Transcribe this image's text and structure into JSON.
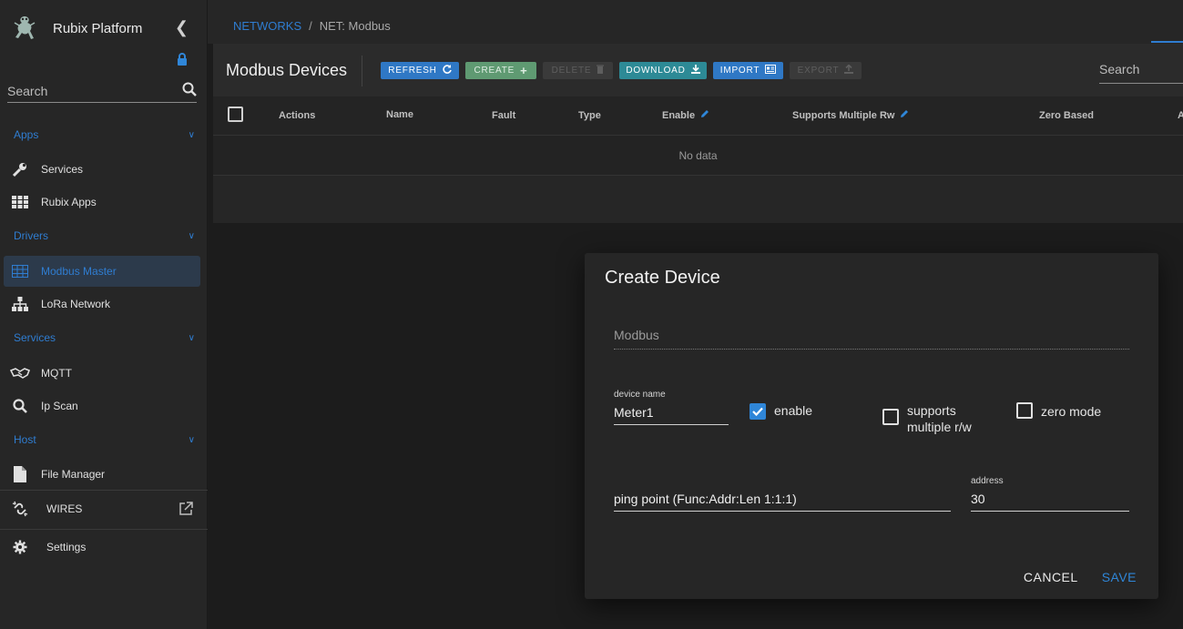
{
  "sidebar": {
    "brand_title": "Rubix Platform",
    "search_placeholder": "Search",
    "sections": {
      "apps": "Apps",
      "drivers": "Drivers",
      "services": "Services",
      "host": "Host"
    },
    "items": {
      "services": "Services",
      "rubix_apps": "Rubix Apps",
      "modbus_master": "Modbus Master",
      "lora_network": "LoRa Network",
      "mqtt": "MQTT",
      "ip_scan": "Ip Scan",
      "file_manager": "File Manager",
      "wires": "WIRES",
      "settings": "Settings"
    },
    "active_item": "modbus_master"
  },
  "breadcrumb": {
    "root": "NETWORKS",
    "current": "NET: Modbus"
  },
  "toolbar": {
    "title": "Modbus Devices",
    "refresh": "REFRESH",
    "create": "CREATE",
    "delete": "DELETE",
    "download": "DOWNLOAD",
    "import": "IMPORT",
    "export": "EXPORT",
    "search_placeholder": "Search"
  },
  "table": {
    "columns": [
      "Actions",
      "Name",
      "Fault",
      "Type",
      "Enable",
      "Supports Multiple Rw",
      "Zero Based",
      "A"
    ],
    "empty_text": "No data"
  },
  "dialog": {
    "title": "Create Device",
    "network_value": "Modbus",
    "device_name_label": "device name",
    "device_name_value": "Meter1",
    "enable_label": "enable",
    "enable_checked": true,
    "supports_multiple_line1": "supports",
    "supports_multiple_line2": "multiple r/w",
    "supports_multiple_checked": false,
    "zero_mode_label": "zero mode",
    "zero_mode_checked": false,
    "ping_point_value": "ping point (Func:Addr:Len 1:1:1)",
    "address_label": "address",
    "address_value": "30",
    "cancel": "CANCEL",
    "save": "SAVE"
  },
  "colors": {
    "accent": "#2f7dd1",
    "create_button": "#5f9a72",
    "download_button": "#2d8a96",
    "checkbox_checked": "#2f86d8"
  }
}
